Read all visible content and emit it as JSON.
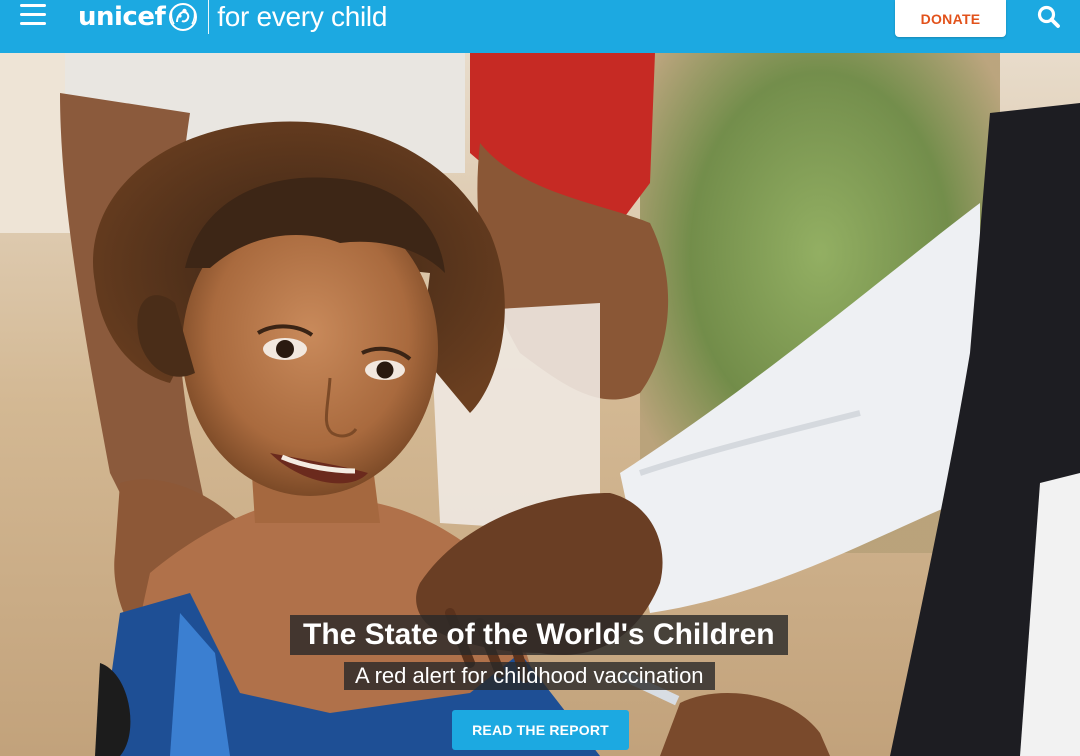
{
  "header": {
    "brand": "unicef",
    "tagline": "for every child",
    "donate_label": "DONATE",
    "icons": [
      "menu-icon",
      "unicef-emblem-icon",
      "search-icon"
    ]
  },
  "hero": {
    "title": "The State of the World's Children",
    "subtitle": "A red alert for childhood vaccination",
    "cta_label": "READ THE REPORT"
  },
  "colors": {
    "brand_blue": "#1ca9e1",
    "donate_text": "#e2521b",
    "caption_bg": "#282828"
  }
}
